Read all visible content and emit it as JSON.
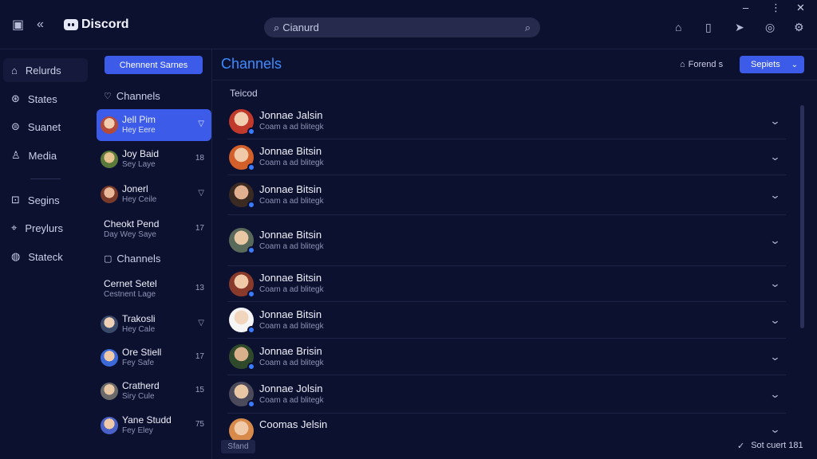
{
  "app": {
    "brand": "Discord",
    "search_text": "Cianurd"
  },
  "nav": {
    "items": [
      {
        "label": "Relurds"
      },
      {
        "label": "States"
      },
      {
        "label": "Suanet"
      },
      {
        "label": "Media"
      },
      {
        "label": "Segins"
      },
      {
        "label": "Preylurs"
      },
      {
        "label": "Stateck"
      }
    ]
  },
  "channels_panel": {
    "primary_button": "Chennent Sarnes",
    "section1_header": "Channels",
    "section2_header": "Channels",
    "items": [
      {
        "title": "Jell Pim",
        "sub": "Hey Eere",
        "meta": ""
      },
      {
        "title": "Joy Baid",
        "sub": "Sey Laye",
        "meta": "18"
      },
      {
        "title": "Jonerl",
        "sub": "Hey Ceile",
        "meta": ""
      },
      {
        "title": "Cheokt Pend",
        "sub": "Day Wey Saye",
        "meta": "17"
      },
      {
        "title": "Cernet Setel",
        "sub": "Cestnent Lage",
        "meta": "13"
      },
      {
        "title": "Trakosli",
        "sub": "Hey Cale",
        "meta": ""
      },
      {
        "title": "Ore Stiell",
        "sub": "Fey Safe",
        "meta": "17"
      },
      {
        "title": "Cratherd",
        "sub": "Siry Cule",
        "meta": "15"
      },
      {
        "title": "Yane Studd",
        "sub": "Fey Eley",
        "meta": "75"
      }
    ]
  },
  "main": {
    "title": "Channels",
    "forward_label": "Forend s",
    "select_label": "Sepiets",
    "group_label": "Teicod",
    "rows": [
      {
        "name": "Jonnae Jalsin",
        "sub": "Coam a ad blitegk"
      },
      {
        "name": "Jonnae Bitsin",
        "sub": "Coam a ad blitegk"
      },
      {
        "name": "Jonnae Bitsin",
        "sub": "Coam a ad blitegk"
      },
      {
        "name": "Jonnae Bitsin",
        "sub": "Coam a ad blitegk"
      },
      {
        "name": "Jonnae Bitsin",
        "sub": "Coam a ad blitegk"
      },
      {
        "name": "Jonnae Bitsin",
        "sub": "Coam a ad blitegk"
      },
      {
        "name": "Jonnae Brisin",
        "sub": "Coam a ad blitegk"
      },
      {
        "name": "Jonnae Jolsin",
        "sub": "Coam a ad blitegk"
      },
      {
        "name": "Coomas Jelsin",
        "sub": ""
      }
    ],
    "footer_button": "Sfand",
    "status_text": "Sot cuert 181"
  },
  "colors": {
    "background": "#0d1130",
    "accent": "#3b5be8",
    "title_blue": "#3c8cff"
  }
}
